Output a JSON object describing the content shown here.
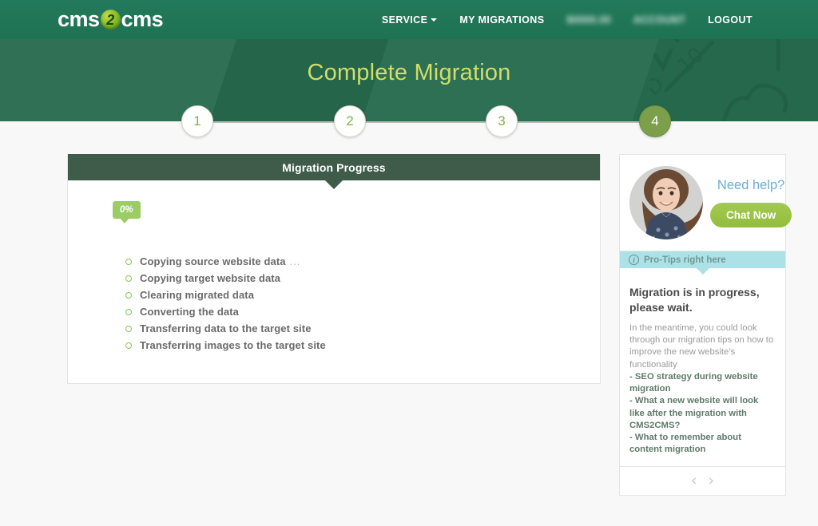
{
  "header": {
    "logo": {
      "left": "cms",
      "mark": "2",
      "right": "cms"
    },
    "nav": [
      {
        "label": "SERVICE",
        "has_caret": true,
        "redacted": false
      },
      {
        "label": "MY MIGRATIONS",
        "has_caret": false,
        "redacted": false
      },
      {
        "label": "$0000.00",
        "has_caret": false,
        "redacted": true
      },
      {
        "label": "ACCOUNT",
        "has_caret": false,
        "redacted": true
      },
      {
        "label": "LOGOUT",
        "has_caret": false,
        "redacted": false
      }
    ]
  },
  "hero": {
    "title": "Complete Migration"
  },
  "stepper": {
    "steps": [
      {
        "number": "1",
        "state": "done"
      },
      {
        "number": "2",
        "state": "done"
      },
      {
        "number": "3",
        "state": "done"
      },
      {
        "number": "4",
        "state": "active"
      }
    ]
  },
  "progress_panel": {
    "title": "Migration Progress",
    "percent_label": "0%",
    "percent_value": 0,
    "tasks": [
      {
        "label": "Copying source website data",
        "trailing": "...",
        "state": "pending"
      },
      {
        "label": "Copying target website data",
        "trailing": "",
        "state": "pending"
      },
      {
        "label": "Clearing migrated data",
        "trailing": "",
        "state": "pending"
      },
      {
        "label": "Converting the data",
        "trailing": "",
        "state": "pending"
      },
      {
        "label": "Transferring data to the target site",
        "trailing": "",
        "state": "pending"
      },
      {
        "label": "Transferring images to the target site",
        "trailing": "",
        "state": "pending"
      }
    ]
  },
  "sidebar": {
    "help": {
      "heading": "Need help?",
      "chat_button": "Chat Now"
    },
    "protips": {
      "bar_label": "Pro-Tips right here",
      "title": "Migration is in progress, please wait.",
      "intro": "In the meantime, you could look through our migration tips on how to improve the new website’s functionality",
      "links": [
        "-  SEO strategy during website migration",
        "-  What a new website will look like after the migration with CMS2CMS?",
        "-  What to remember about content migration"
      ],
      "prev_arrow": "‹",
      "next_arrow": "›"
    }
  },
  "colors": {
    "header_green": "#1f7a5a",
    "hero_green": "#276b4e",
    "hero_title": "#cfdd6a",
    "panel_head": "#3e5c49",
    "accent_green": "#8cc152",
    "badge_green": "#9ccc65",
    "step_active": "#7b9f4a",
    "protips_cyan": "#ade1e8",
    "need_help_blue": "#6aaed6",
    "page_bg": "#f8f8f8"
  }
}
